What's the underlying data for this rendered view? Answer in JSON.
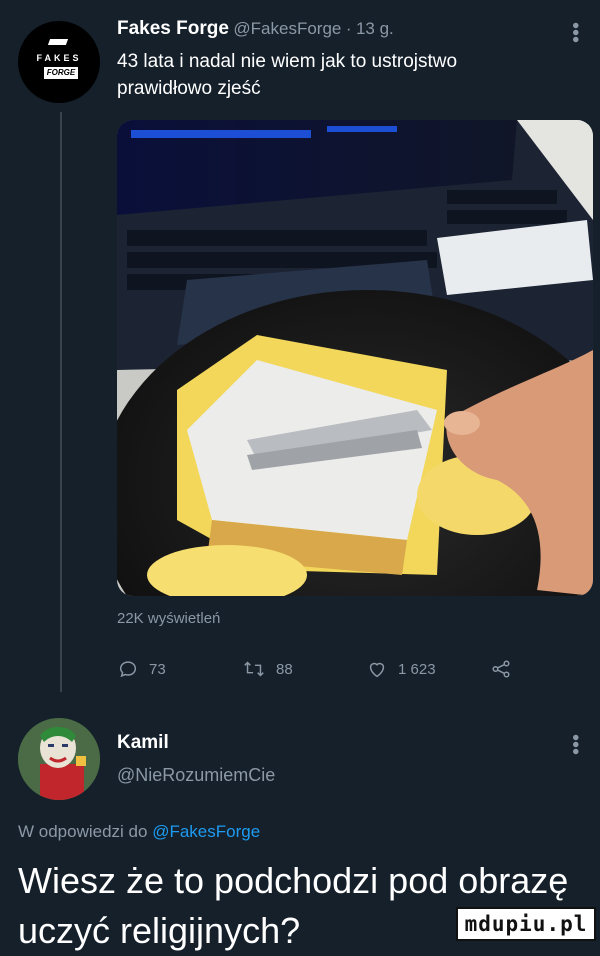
{
  "tweet": {
    "author_name": "Fakes Forge",
    "handle": "@FakesForge",
    "separator": "·",
    "time": "13 g.",
    "text": "43 lata i nadal nie wiem jak to ustrojstwo prawidłowo zjeść",
    "avatar_label_top": "FAKES",
    "avatar_label_bottom": "FORGE",
    "views": "22K wyświetleń",
    "replies": "73",
    "retweets": "88",
    "likes": "1 623"
  },
  "reply": {
    "author_name": "Kamil",
    "handle": "@NieRozumiemCie",
    "in_reply_prefix": "W odpowiedzi do",
    "in_reply_handle": "@FakesForge",
    "text": "Wiesz że to podchodzi pod obrazę uczyć religijnych?"
  },
  "watermark": "mdupiu.pl",
  "colors": {
    "background": "#15202b",
    "muted": "#8b98a5",
    "link": "#1d9bf0"
  }
}
